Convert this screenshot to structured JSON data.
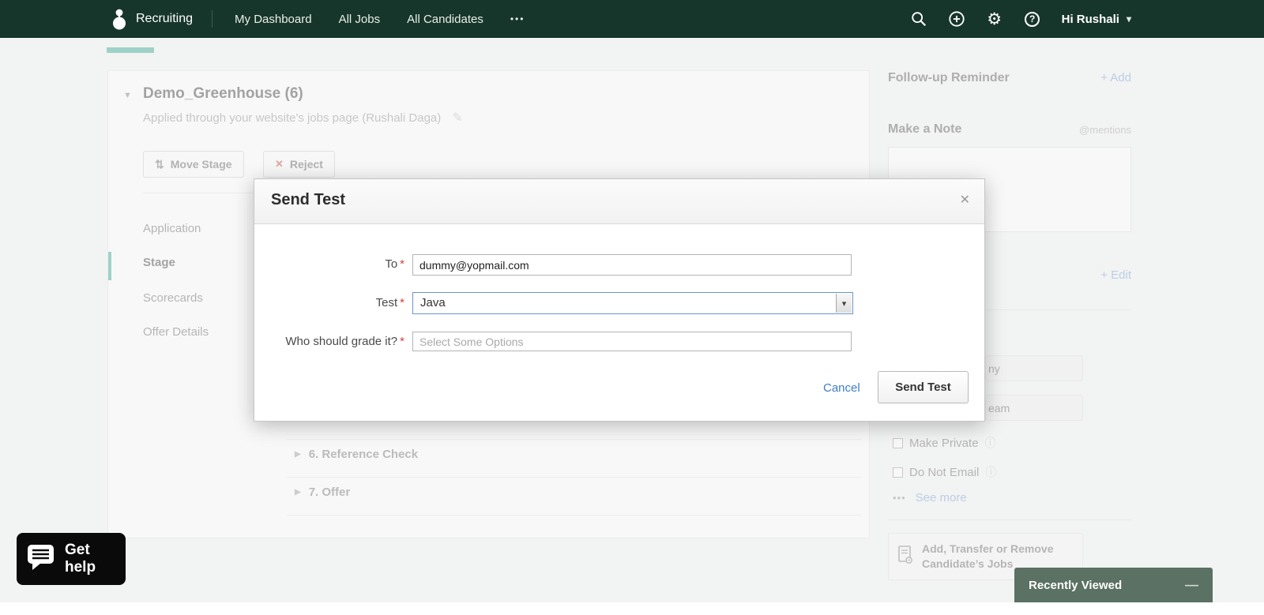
{
  "colors": {
    "nav_bg": "#17362b",
    "accent_teal": "#2aa48c",
    "link_blue": "#6f9bd2"
  },
  "nav": {
    "brand": "Recruiting",
    "items": [
      "My Dashboard",
      "All Jobs",
      "All Candidates"
    ],
    "overflow": "•••",
    "user": "Hi Rushali",
    "user_chevron": "▾"
  },
  "candidate_panel": {
    "collapse_icon": "▼",
    "title": "Demo_Greenhouse (6)",
    "subtitle": "Applied through your website's jobs page (Rushali Daga)",
    "edit_icon": "✎",
    "move_stage": {
      "icon": "⇅",
      "label": "Move Stage"
    },
    "reject": {
      "icon": "✕",
      "label": "Reject"
    },
    "tabs": [
      "Application",
      "Stage",
      "Scorecards",
      "Offer Details"
    ],
    "stages": [
      {
        "icon": "▶",
        "label": "6. Reference Check"
      },
      {
        "icon": "▶",
        "label": "7. Offer"
      }
    ]
  },
  "sidebar": {
    "followup": {
      "title": "Follow-up Reminder",
      "action": "+ Add"
    },
    "note": {
      "title": "Make a Note",
      "hint": "@mentions"
    },
    "edit_action": "+ Edit",
    "partial_buttons": [
      "ny",
      "eam"
    ],
    "checkboxes": [
      {
        "label": "Make Private",
        "info_icon": "ⓘ"
      },
      {
        "label": "Do Not Email",
        "info_icon": "ⓘ"
      }
    ],
    "more": {
      "dots": "•••",
      "label": "See more"
    },
    "jobs_box": {
      "line1": "Add, Transfer or Remove",
      "line2": "Candidate’s Jobs"
    }
  },
  "modal": {
    "title": "Send Test",
    "close_icon": "✕",
    "required_mark": "*",
    "fields": [
      {
        "label": "To",
        "value": "dummy@yopmail.com"
      },
      {
        "label": "Test",
        "value": "Java",
        "dropdown_icon": "▾"
      },
      {
        "label": "Who should grade it?",
        "placeholder": "Select Some Options"
      }
    ],
    "cancel": "Cancel",
    "submit": "Send Test"
  },
  "widgets": {
    "get_help": "Get help",
    "recently_viewed": "Recently Viewed",
    "minimize_icon": "—",
    "help_q": "?"
  }
}
